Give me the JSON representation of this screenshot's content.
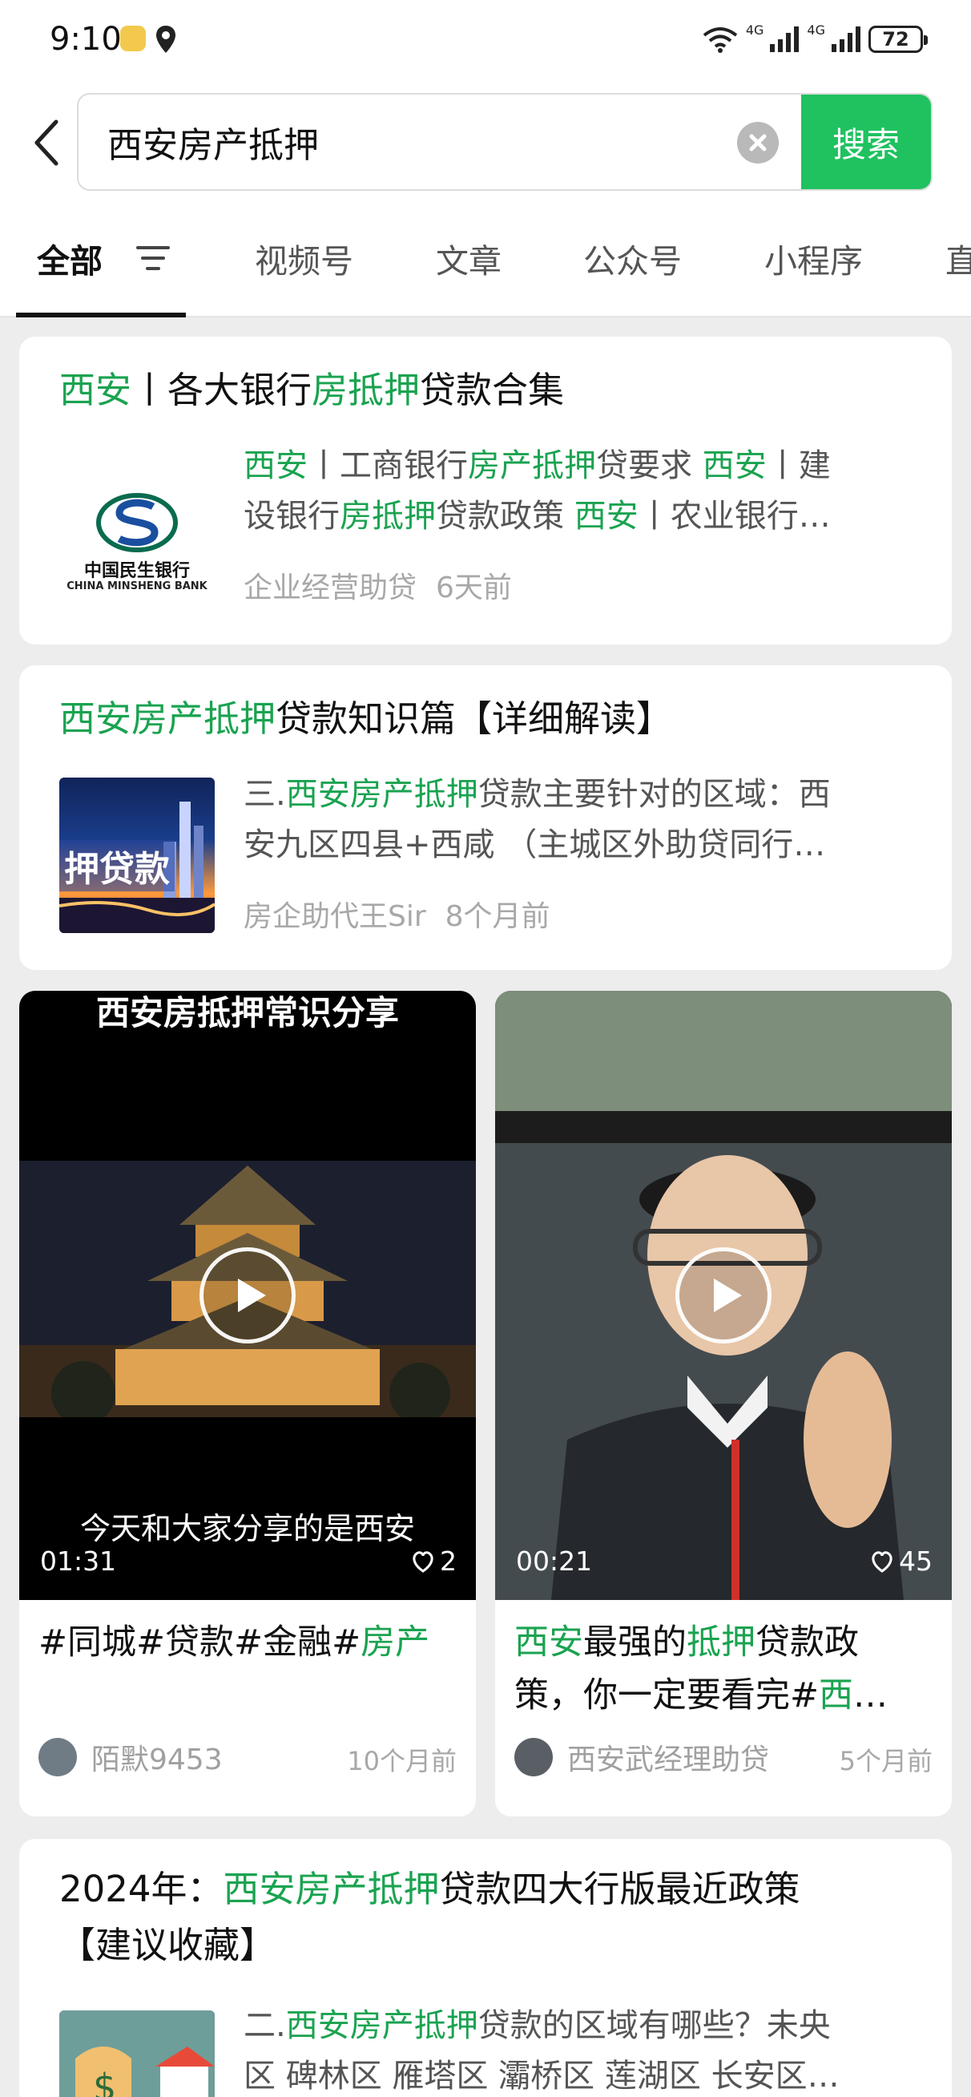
{
  "status_bar": {
    "time": "9:10",
    "net1": "4G",
    "net2": "4G",
    "battery": "72"
  },
  "search": {
    "query": "西安房产抵押",
    "button_label": "搜索"
  },
  "tabs": [
    "全部",
    "视频号",
    "文章",
    "公众号",
    "小程序",
    "直"
  ],
  "active_tab": "全部",
  "colors": {
    "accent": "#1fc25f",
    "highlight": "#1aa350"
  },
  "results": [
    {
      "title": {
        "part1": "西安",
        "part2": "丨各大银行",
        "part3": "房抵押",
        "part4": "贷款合集"
      },
      "thumb_text": {
        "cn": "中国民生银行",
        "en": "CHINA MINSHENG BANK"
      },
      "snippet": {
        "l1a": "西安",
        "l1b": "丨工商银行",
        "l1c": "房产抵押",
        "l1d": "贷要求 ",
        "l1e": "西安",
        "l1f": "丨建",
        "l2a": "设银行",
        "l2b": "房抵押",
        "l2c": "贷款政策 ",
        "l2d": "西安",
        "l2e": "丨农业银行…"
      },
      "source": "企业经营助贷",
      "time": "6天前"
    },
    {
      "title": {
        "part1": "西安房产抵押",
        "part2": "贷款知识篇【详细解读】"
      },
      "thumb_text": "押贷款",
      "snippet": {
        "l1a": "三.",
        "l1b": "西安房产抵押",
        "l1c": "贷款主要针对的区域：西",
        "l2": "安九区四县+西咸 （主城区外助贷同行…"
      },
      "source": "房企助代王Sir",
      "time": "8个月前"
    }
  ],
  "videos": [
    {
      "overlay_title": "西安房抵押常识分享",
      "caption": "今天和大家分享的是西安",
      "duration": "01:31",
      "likes": "2",
      "title": {
        "a": "#同城#贷款#金融#",
        "b": "房产"
      },
      "author": "陌默9453",
      "time": "10个月前"
    },
    {
      "duration": "00:21",
      "likes": "45",
      "title": {
        "a": "西安",
        "b": "最强的",
        "c": "抵押",
        "d": "贷款政",
        "e": "策，你一定要看完#",
        "f": "西",
        "g": "…"
      },
      "author": "西安武经理助贷",
      "time": "5个月前"
    }
  ],
  "article": {
    "title": {
      "a": "2024年：",
      "b": "西安房产抵押",
      "c": "贷款四大行版最近政策",
      "d": "【建议收藏】"
    },
    "snippet": {
      "l1a": "二.",
      "l1b": "西安房产抵押",
      "l1c": "贷款的区域有哪些？未央",
      "l2": "区 碑林区 雁塔区 灞桥区 莲湖区 长安区…"
    }
  }
}
